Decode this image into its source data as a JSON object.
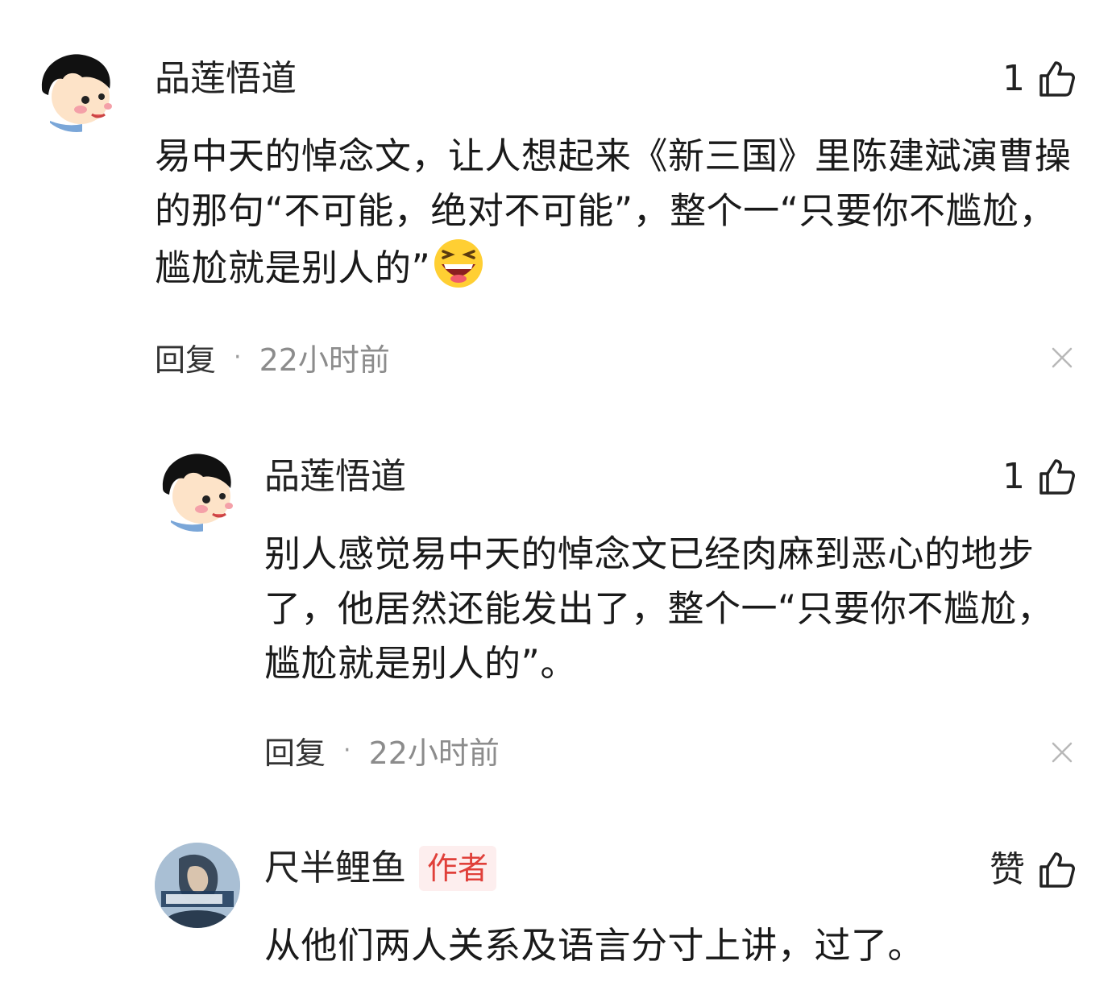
{
  "comments": [
    {
      "user": "品莲悟道",
      "likes": "1",
      "text": "易中天的悼念文，让人想起来《新三国》里陈建斌演曹操的那句“不可能，绝对不可能”，整个一“只要你不尴尬，尴尬就是别人的”",
      "emoji": "laughing-emoji",
      "reply_label": "回复",
      "separator": "·",
      "time": "22小时前"
    },
    {
      "user": "品莲悟道",
      "likes": "1",
      "text": "别人感觉易中天的悼念文已经肉麻到恶心的地步了，他居然还能发出了，整个一“只要你不尴尬，尴尬就是别人的”。",
      "reply_label": "回复",
      "separator": "·",
      "time": "22小时前"
    },
    {
      "user": "尺半鲤鱼",
      "badge": "作者",
      "likes": "赞",
      "text": "从他们两人关系及语言分寸上讲，过了。"
    }
  ],
  "icons": {
    "like": "thumbs-up-icon",
    "close": "close-icon"
  },
  "colors": {
    "badge_bg": "#fdeeee",
    "badge_text": "#e0403a",
    "meta_text": "#8c8c8c"
  }
}
